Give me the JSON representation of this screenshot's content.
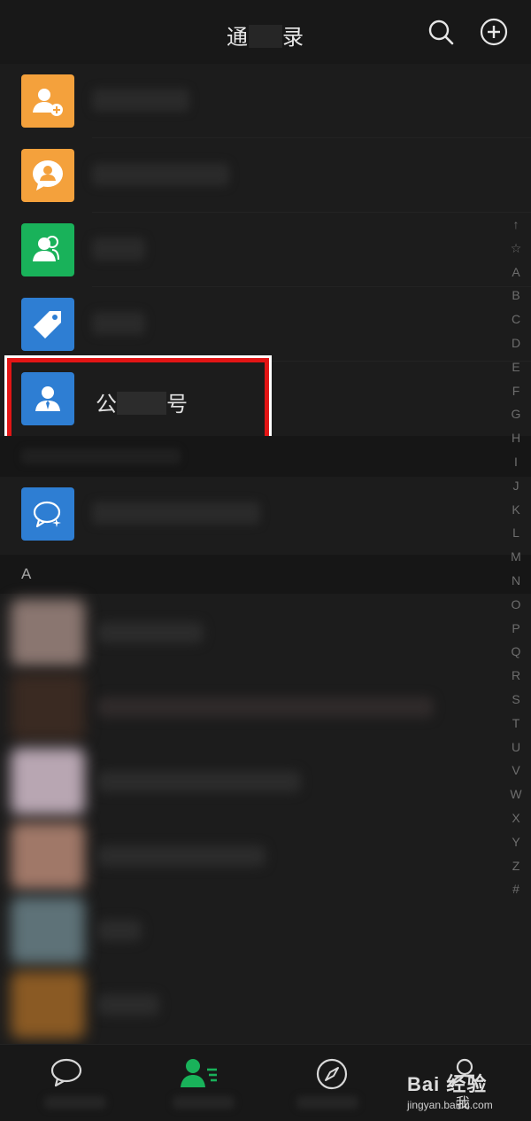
{
  "header": {
    "title_start": "通",
    "title_end": "录",
    "search_icon": "search-icon",
    "add_icon": "plus-circle-icon"
  },
  "entries": [
    {
      "icon": "add-friend-icon",
      "color": "#f4a13c"
    },
    {
      "icon": "group-chat-icon",
      "color": "#f4a13c"
    },
    {
      "icon": "contacts-group-icon",
      "color": "#19b25a"
    },
    {
      "icon": "tag-icon",
      "color": "#2e7ed3"
    },
    {
      "icon": "official-account-icon",
      "color": "#2e7ed3",
      "label_start": "公",
      "label_end": "号"
    },
    {
      "icon": "chat-sparkle-icon",
      "color": "#2e7ed3"
    }
  ],
  "section": {
    "letter": "A"
  },
  "index_letters": [
    "↑",
    "☆",
    "A",
    "B",
    "C",
    "D",
    "E",
    "F",
    "G",
    "H",
    "I",
    "J",
    "K",
    "L",
    "M",
    "N",
    "O",
    "P",
    "Q",
    "R",
    "S",
    "T",
    "U",
    "V",
    "W",
    "X",
    "Y",
    "Z",
    "#"
  ],
  "tabbar": {
    "tabs": [
      {
        "icon": "chat-icon",
        "active": false
      },
      {
        "icon": "contacts-icon",
        "active": true
      },
      {
        "icon": "discover-compass-icon",
        "active": false
      },
      {
        "icon": "me-icon",
        "active": false
      }
    ],
    "me_label": "我"
  },
  "watermark": {
    "brand": "Bai 经验",
    "url": "jingyan.baidu.com"
  },
  "colors": {
    "accent_green": "#19b25a",
    "highlight_red": "#e21515"
  }
}
